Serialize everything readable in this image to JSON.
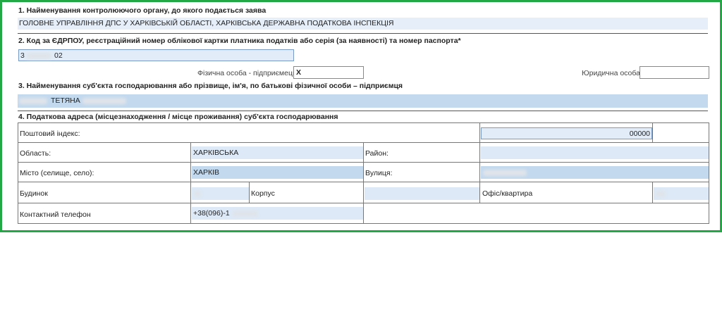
{
  "section1": {
    "header": "1. Найменування контролюючого органу, до якого подається заява",
    "value": "ГОЛОВНЕ УПРАВЛІННЯ ДПС У ХАРКІВСЬКІЙ ОБЛАСТІ, ХАРКІВСЬКА ДЕРЖАВНА ПОДАТКОВА ІНСПЕКЦІЯ"
  },
  "section2": {
    "header": "2. Код за ЄДРПОУ, реєстраційний номер облікової картки платника податків або серія (за наявності) та номер паспорта*",
    "code_prefix": "3",
    "code_suffix": "02",
    "individual_label": "Фізична особа - підприємець",
    "individual_value": "X",
    "legal_label": "Юридична особа",
    "legal_value": ""
  },
  "section3": {
    "header": "3. Найменування суб'єкта господарювання або прізвище, ім'я, по батькові фізичної особи – підприємця",
    "name_visible": "ТЕТЯНА"
  },
  "section4": {
    "header": "4. Податкова адреса (місцезнаходження / місце проживання) суб'єкта господарювання",
    "postal_label": "Поштовий індекс:",
    "postal_value": "00000",
    "region_label": "Область:",
    "region_value": "ХАРКІВСЬКА",
    "district_label": "Район:",
    "district_value": "",
    "city_label": "Місто (селище, село):",
    "city_value": "ХАРКІВ",
    "street_label": "Вулиця:",
    "building_label": "Будинок",
    "block_label": "Корпус",
    "block_value": "",
    "office_label": "Офіс/квартира",
    "phone_label": "Контактний телефон",
    "phone_value": "+38(096)-1"
  }
}
